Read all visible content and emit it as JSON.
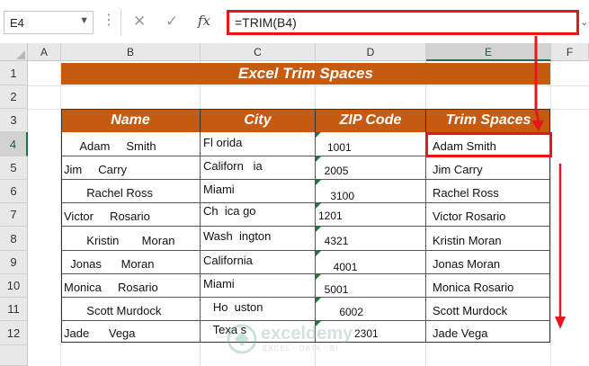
{
  "namebox": {
    "value": "E4"
  },
  "formula_bar": {
    "formula": "=TRIM(B4)",
    "cancel_glyph": "✕",
    "enter_glyph": "✓",
    "fx_glyph": "fx"
  },
  "columns": [
    "A",
    "B",
    "C",
    "D",
    "E",
    "F"
  ],
  "rows": [
    "1",
    "2",
    "3",
    "4",
    "5",
    "6",
    "7",
    "8",
    "9",
    "10",
    "11",
    "12"
  ],
  "title": "Excel Trim Spaces",
  "table": {
    "headers": [
      "Name",
      "City",
      "ZIP Code",
      "Trim Spaces"
    ],
    "rows": [
      {
        "name": "     Adam     Smith",
        "city": "Fl orida",
        "zip": "   1001",
        "trim": "Adam Smith"
      },
      {
        "name": "Jim     Carry",
        "city": "Californ   ia",
        "zip": "  2005",
        "trim": "Jim Carry"
      },
      {
        "name": "       Rachel Ross",
        "city": "Miami",
        "zip": "    3100",
        "trim": "Rachel Ross"
      },
      {
        "name": "Victor     Rosario",
        "city": "Ch  ica go",
        "zip": "1201",
        "trim": "Victor Rosario"
      },
      {
        "name": "       Kristin       Moran",
        "city": "Wash  ington",
        "zip": "  4321",
        "trim": "Kristin Moran"
      },
      {
        "name": "  Jonas      Moran",
        "city": "California",
        "zip": "     4001",
        "trim": "Jonas Moran"
      },
      {
        "name": "Monica     Rosario",
        "city": "Miami",
        "zip": "  5001",
        "trim": "Monica Rosario"
      },
      {
        "name": "       Scott Murdock",
        "city": "   Ho  uston",
        "zip": "       6002",
        "trim": "Scott Murdock"
      },
      {
        "name": "Jade      Vega",
        "city": "   Texa s",
        "zip": "            2301",
        "trim": "Jade Vega"
      }
    ]
  },
  "watermark": {
    "name": "exceldemy",
    "tagline": "EXCEL · DATA · BI"
  },
  "colors": {
    "header_orange": "#c55a11",
    "highlight_red": "#e6161c",
    "excel_green": "#217346"
  }
}
